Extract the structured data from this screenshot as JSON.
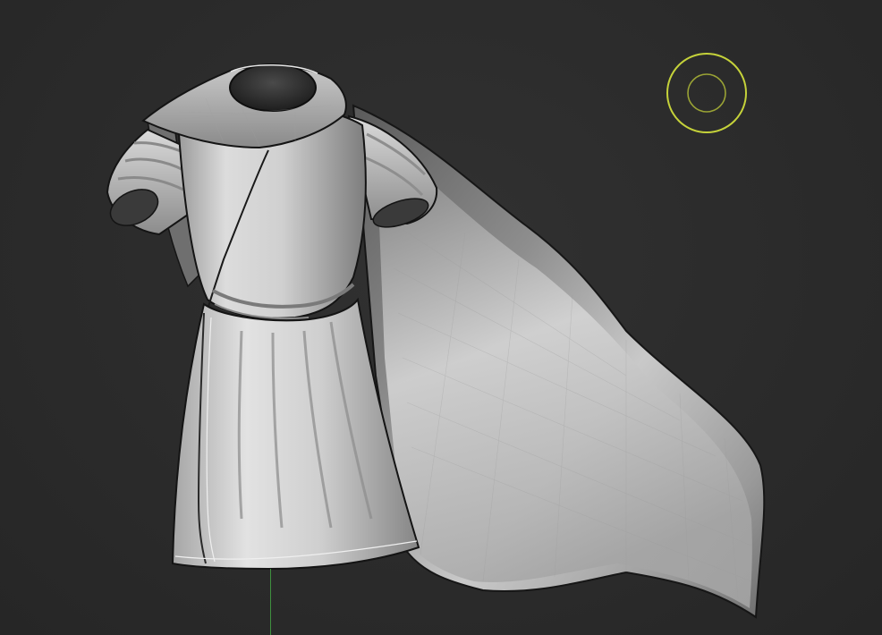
{
  "viewport": {
    "background_color": "#2b2b2b"
  },
  "model": {
    "cloth_color": "#b8b8b8",
    "cloth_highlight": "#e6e6e6",
    "cloth_shadow": "#6a6a6a",
    "outline_color": "#141414"
  },
  "gizmo": {
    "icon": "navigation-gizmo-icon",
    "color": "#c5d23a"
  },
  "axis": {
    "icon": "y-axis-line",
    "color": "#3f8f3f"
  }
}
